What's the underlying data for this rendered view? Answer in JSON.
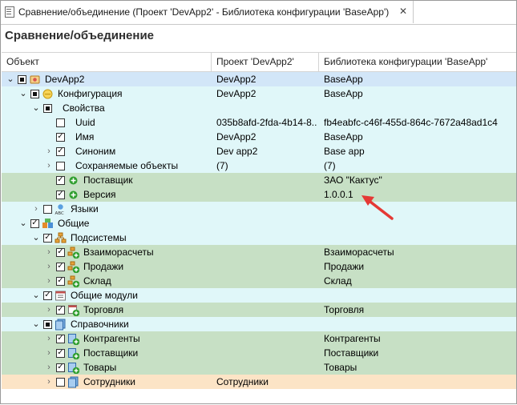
{
  "window": {
    "tab_title": "Сравнение/объединение (Проект 'DevApp2' - Библиотека конфигурации 'BaseApp')",
    "close_glyph": "✕"
  },
  "page": {
    "title": "Сравнение/объединение"
  },
  "columns": {
    "object": "Объект",
    "project": "Проект 'DevApp2'",
    "library": "Библиотека конфигурации 'BaseApp'"
  },
  "rows": [
    {
      "label": "DevApp2",
      "project": "DevApp2",
      "library": "BaseApp",
      "icon": "config-root-icon",
      "check": "partial",
      "expander": "expanded"
    },
    {
      "label": "Конфигурация",
      "project": "DevApp2",
      "library": "BaseApp",
      "icon": "configuration-icon",
      "check": "partial",
      "expander": "expanded"
    },
    {
      "label": "Свойства",
      "project": "",
      "library": "",
      "icon": "",
      "check": "partial",
      "expander": "expanded"
    },
    {
      "label": "Uuid",
      "project": "035b8afd-2fda-4b14-8...",
      "library": "fb4eabfc-c46f-455d-864c-7672a48ad1c4",
      "icon": "",
      "check": "unchecked",
      "expander": "none"
    },
    {
      "label": "Имя",
      "project": "DevApp2",
      "library": "BaseApp",
      "icon": "",
      "check": "checked",
      "expander": "none"
    },
    {
      "label": "Синоним",
      "project": "Dev app2",
      "library": "Base app",
      "icon": "",
      "check": "checked",
      "expander": "collapsed"
    },
    {
      "label": "Сохраняемые объекты",
      "project": "(7)",
      "library": "(7)",
      "icon": "",
      "check": "unchecked",
      "expander": "collapsed"
    },
    {
      "label": "Поставщик",
      "project": "",
      "library": "ЗАО \"Кактус\"",
      "icon": "plus-icon",
      "check": "checked",
      "expander": "none"
    },
    {
      "label": "Версия",
      "project": "",
      "library": "1.0.0.1",
      "icon": "plus-icon",
      "check": "checked",
      "expander": "none"
    },
    {
      "label": "Языки",
      "project": "",
      "library": "",
      "icon": "languages-icon",
      "check": "unchecked",
      "expander": "collapsed"
    },
    {
      "label": "Общие",
      "project": "",
      "library": "",
      "icon": "common-icon",
      "check": "checked",
      "expander": "expanded"
    },
    {
      "label": "Подсистемы",
      "project": "",
      "library": "",
      "icon": "subsystems-icon",
      "check": "checked",
      "expander": "expanded"
    },
    {
      "label": "Взаиморасчеты",
      "project": "",
      "library": "Взаиморасчеты",
      "icon": "subsystem-add-icon",
      "check": "checked",
      "expander": "collapsed"
    },
    {
      "label": "Продажи",
      "project": "",
      "library": "Продажи",
      "icon": "subsystem-add-icon",
      "check": "checked",
      "expander": "collapsed"
    },
    {
      "label": "Склад",
      "project": "",
      "library": "Склад",
      "icon": "subsystem-add-icon",
      "check": "checked",
      "expander": "collapsed"
    },
    {
      "label": "Общие модули",
      "project": "",
      "library": "",
      "icon": "common-modules-icon",
      "check": "checked",
      "expander": "expanded"
    },
    {
      "label": "Торговля",
      "project": "",
      "library": "Торговля",
      "icon": "module-add-icon",
      "check": "checked",
      "expander": "collapsed"
    },
    {
      "label": "Справочники",
      "project": "",
      "library": "",
      "icon": "catalogs-icon",
      "check": "partial",
      "expander": "expanded"
    },
    {
      "label": "Контрагенты",
      "project": "",
      "library": "Контрагенты",
      "icon": "catalog-add-icon",
      "check": "checked",
      "expander": "collapsed"
    },
    {
      "label": "Поставщики",
      "project": "",
      "library": "Поставщики",
      "icon": "catalog-add-icon",
      "check": "checked",
      "expander": "collapsed"
    },
    {
      "label": "Товары",
      "project": "",
      "library": "Товары",
      "icon": "catalog-add-icon",
      "check": "checked",
      "expander": "collapsed"
    },
    {
      "label": "Сотрудники",
      "project": "Сотрудники",
      "library": "",
      "icon": "catalog-icon",
      "check": "unchecked",
      "expander": "collapsed"
    }
  ],
  "colors": {
    "selected_row": "#d2e6f8",
    "match_row": "#e0f7f9",
    "added_row": "#c7e0c5",
    "removed_row": "#fce4c6",
    "annotation_arrow": "#e53935",
    "add_badge": "#2e9e2e"
  },
  "annotation": {
    "icon": "red-arrow-icon",
    "points_to": "Версия"
  }
}
